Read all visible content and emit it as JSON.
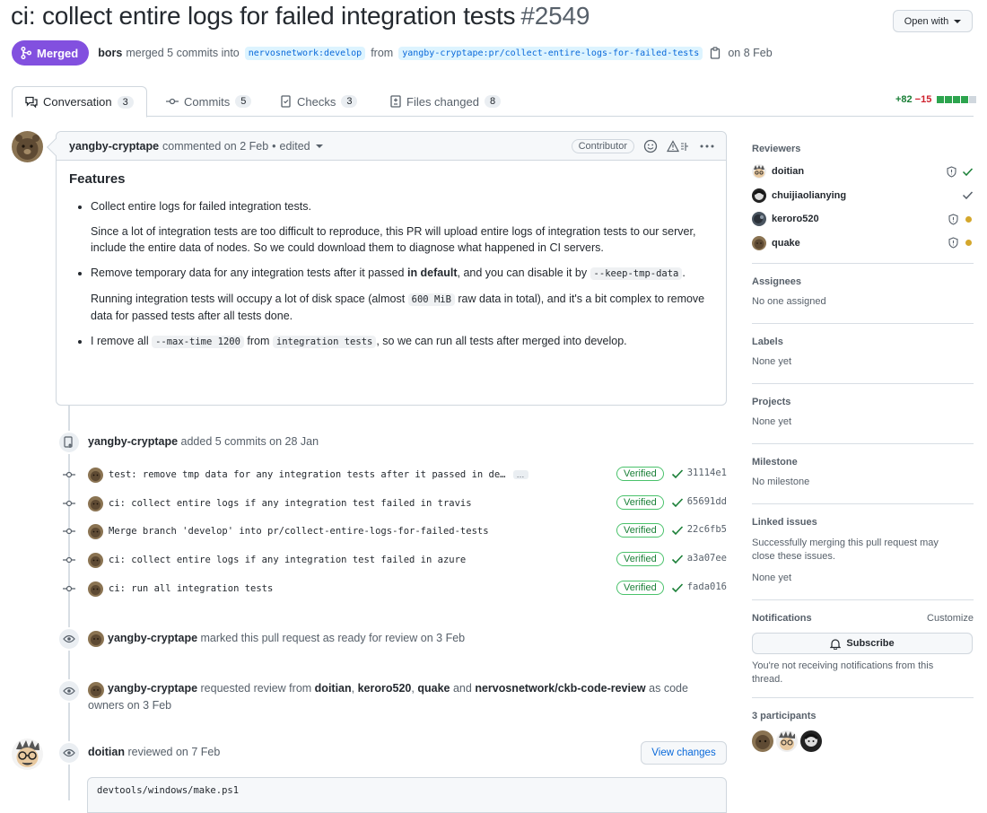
{
  "pr": {
    "title": "ci: collect entire logs for failed integration tests",
    "number": "#2549",
    "open_with_label": "Open with",
    "status": "Merged",
    "merged_by": "bors",
    "merged_text": "merged 5 commits into",
    "base_branch": "nervosnetwork:develop",
    "from_text": "from",
    "head_branch": "yangby-cryptape:pr/collect-entire-logs-for-failed-tests",
    "date_text": "on 8 Feb"
  },
  "tabs": [
    {
      "label": "Conversation",
      "count": "3"
    },
    {
      "label": "Commits",
      "count": "5"
    },
    {
      "label": "Checks",
      "count": "3"
    },
    {
      "label": "Files changed",
      "count": "8"
    }
  ],
  "diffstat": {
    "additions": "+82",
    "deletions": "−15",
    "filled_blocks": 4,
    "total_blocks": 5
  },
  "comment": {
    "author": "yangby-cryptape",
    "action": "commented on 2 Feb",
    "sep": "•",
    "edited": "edited",
    "role": "Contributor",
    "heading": "Features",
    "items": [
      {
        "lead": "Collect entire logs for failed integration tests.",
        "para": "Since a lot of integration tests are too difficult to reproduce, this PR will upload entire logs of integration tests to our server, include the entire data of nodes. So we could download them to diagnose what happened in CI servers."
      },
      {
        "lead_a": "Remove temporary data for any integration tests after it passed ",
        "lead_bold": "in default",
        "lead_b": ", and you can disable it by ",
        "lead_code": "--keep-tmp-data",
        "lead_c": ".",
        "para_a": "Running integration tests will occupy a lot of disk space (almost ",
        "para_code": "600 MiB",
        "para_b": " raw data in total), and it's a bit complex to remove data for passed tests after all tests done."
      },
      {
        "a": "I remove all ",
        "code1": "--max-time 1200",
        "b": " from ",
        "code2": "integration tests",
        "c": ", so we can run all tests after merged into develop."
      }
    ]
  },
  "commits_event": {
    "author": "yangby-cryptape",
    "text": "added 5 commits on 28 Jan"
  },
  "commits": [
    {
      "message": "test: remove tmp data for any integration tests after it passed in de…",
      "more": "…",
      "verified": "Verified",
      "sha": "31114e1"
    },
    {
      "message": "ci: collect entire logs if any integration test failed in travis",
      "verified": "Verified",
      "sha": "65691dd"
    },
    {
      "message": "Merge branch 'develop' into pr/collect-entire-logs-for-failed-tests",
      "verified": "Verified",
      "sha": "22c6fb5"
    },
    {
      "message": "ci: collect entire logs if any integration test failed in azure",
      "verified": "Verified",
      "sha": "a3a07ee"
    },
    {
      "message": "ci: run all integration tests",
      "verified": "Verified",
      "sha": "fada016"
    }
  ],
  "ready_event": {
    "author": "yangby-cryptape",
    "text": "marked this pull request as ready for review on 3 Feb"
  },
  "review_request_event": {
    "author": "yangby-cryptape",
    "text_a": "requested review from",
    "r1": "doitian",
    "comma1": ",",
    "r2": "keroro520",
    "comma2": ",",
    "r3": "quake",
    "and": "and",
    "r4": "nervosnetwork/ckb-code-review",
    "text_b": "as code",
    "line2": "owners on 3 Feb"
  },
  "review_event": {
    "author": "doitian",
    "text": "reviewed on 7 Feb",
    "button": "View changes",
    "file": "devtools/windows/make.ps1"
  },
  "sidebar": {
    "reviewers_title": "Reviewers",
    "reviewers": [
      {
        "name": "doitian",
        "status": "approved",
        "codeowner": true
      },
      {
        "name": "chuijiaolianying",
        "status": "approved",
        "codeowner": false
      },
      {
        "name": "keroro520",
        "status": "pending",
        "codeowner": true
      },
      {
        "name": "quake",
        "status": "pending",
        "codeowner": true
      }
    ],
    "assignees_title": "Assignees",
    "assignees_text": "No one assigned",
    "labels_title": "Labels",
    "labels_text": "None yet",
    "projects_title": "Projects",
    "projects_text": "None yet",
    "milestone_title": "Milestone",
    "milestone_text": "No milestone",
    "linked_title": "Linked issues",
    "linked_desc": "Successfully merging this pull request may close these issues.",
    "linked_text": "None yet",
    "notifications_title": "Notifications",
    "customize": "Customize",
    "subscribe": "Subscribe",
    "notif_desc": "You're not receiving notifications from this thread.",
    "participants_title": "3 participants"
  },
  "colors": {
    "merged": "#8250df",
    "link": "#0969da",
    "verified": "#1a7f37",
    "pending": "#d4a72c"
  }
}
